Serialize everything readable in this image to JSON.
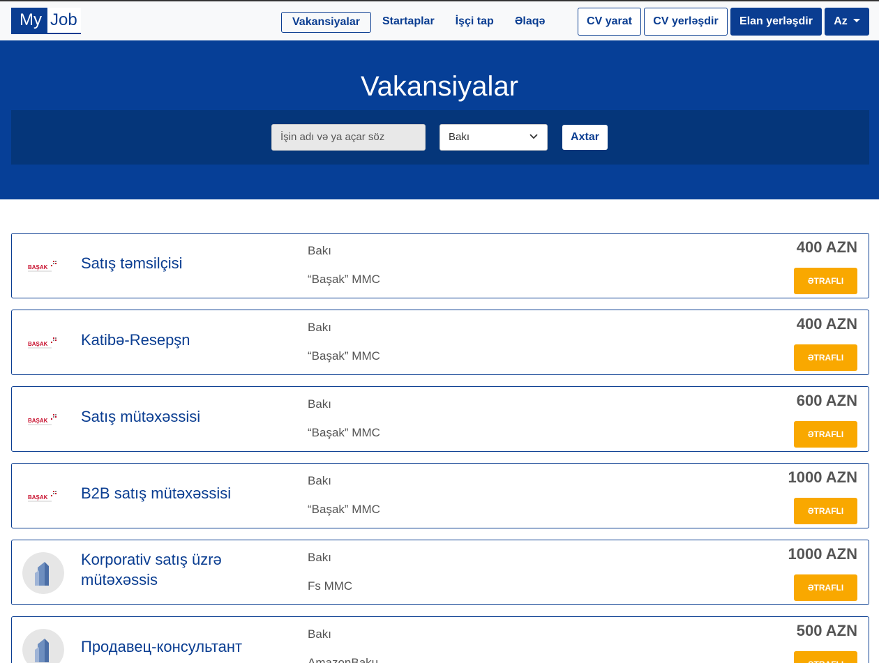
{
  "brand": {
    "part1": "My",
    "part2": "Job"
  },
  "nav": {
    "items": [
      "Vakansiyalar",
      "Startaplar",
      "İşçi tap",
      "Əlaqə"
    ]
  },
  "header_buttons": {
    "cv_create": "CV yarat",
    "cv_post": "CV yerləşdir",
    "post_ad": "Elan yerləşdir",
    "language": "Az"
  },
  "hero": {
    "title": "Vakansiyalar",
    "search_placeholder": "İşin adı və ya açar söz",
    "city_selected": "Bakı",
    "search_button": "Axtar"
  },
  "colors": {
    "primary": "#0a3d91",
    "hero_bg": "#063f97",
    "search_band": "#05367a",
    "accent_button": "#f9a800"
  },
  "jobs": [
    {
      "title": "Satış təmsilçisi",
      "city": "Bakı",
      "company": "“Başak” MMC",
      "salary": "400 AZN",
      "button": "ƏTRAFLI",
      "logo": "basak-logo-icon",
      "logo_text": "BAŞAK"
    },
    {
      "title": "Katibə-Resepşn",
      "city": "Bakı",
      "company": "“Başak” MMC",
      "salary": "400 AZN",
      "button": "ƏTRAFLI",
      "logo": "basak-logo-icon",
      "logo_text": "BAŞAK"
    },
    {
      "title": "Satış mütəxəssisi",
      "city": "Bakı",
      "company": "“Başak” MMC",
      "salary": "600 AZN",
      "button": "ƏTRAFLI",
      "logo": "basak-logo-icon",
      "logo_text": "BAŞAK"
    },
    {
      "title": "B2B satış mütəxəssisi",
      "city": "Bakı",
      "company": "“Başak” MMC",
      "salary": "1000 AZN",
      "button": "ƏTRAFLI",
      "logo": "basak-logo-icon",
      "logo_text": "BAŞAK"
    },
    {
      "title": "Korporativ satış üzrə mütəxəssis",
      "city": "Bakı",
      "company": "Fs MMC",
      "salary": "1000 AZN",
      "button": "ƏTRAFLI",
      "logo": "building-icon"
    },
    {
      "title": "Продавец-консультант",
      "city": "Bakı",
      "company": "AmazonBaku",
      "salary": "500 AZN",
      "button": "ƏTRAFLI",
      "logo": "building-icon"
    }
  ]
}
